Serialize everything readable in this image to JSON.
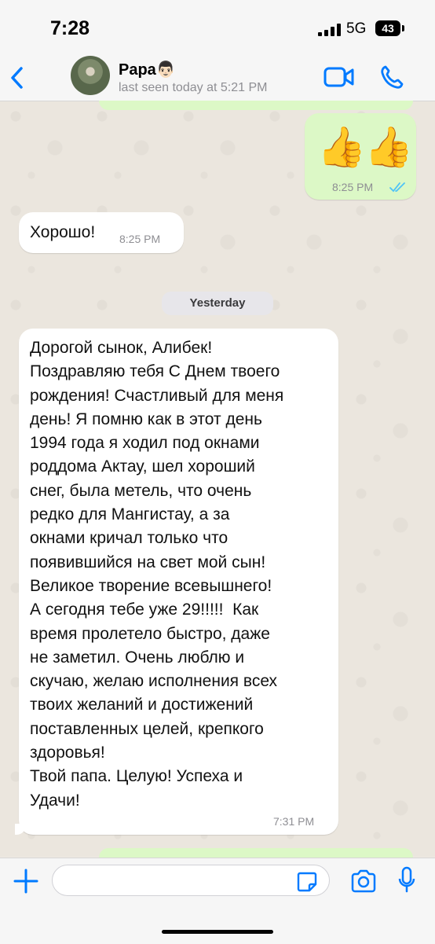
{
  "status_bar": {
    "time": "7:28",
    "network": "5G",
    "battery": "43"
  },
  "header": {
    "contact_name": "Papa",
    "contact_emoji": "👨🏻",
    "last_seen": "last seen today at 5:21 PM",
    "icons": [
      "back-chevron-icon",
      "video-call-icon",
      "phone-call-icon"
    ]
  },
  "messages": [
    {
      "direction": "outgoing",
      "content": "👍👍",
      "time": "8:25 PM",
      "status": "read"
    },
    {
      "direction": "incoming",
      "text": "Хорошо!",
      "time": "8:25 PM"
    },
    {
      "direction": "incoming",
      "lines": [
        "Дорогой сынок, Алибек!",
        "Поздравляю тебя С Днем твоего",
        "рождения! Счастливый для меня",
        "день! Я помню как в этот день",
        "1994 года я ходил под окнами",
        "роддома Актау, шел хороший",
        "снег, была метель, что очень",
        "редко для Мангистау, а за",
        "окнами кричал только что",
        "появившийся на свет мой сын!",
        "Великое творение всевышнего!",
        "А сегодня тебе уже 29!!!!!  Как",
        "время пролетело быстро, даже",
        "не заметил. Очень люблю и",
        "скучаю, желаю исполнения всех",
        "твоих желаний и достижений",
        "поставленных целей, крепкого",
        "здоровья!",
        "Твой папа. Целую! Успеха и",
        "Удачи!"
      ],
      "time": "7:31 PM"
    }
  ],
  "day_separator": "Yesterday",
  "input_bar": {
    "placeholder": "",
    "icons": [
      "plus-icon",
      "sticker-icon",
      "camera-icon",
      "microphone-icon"
    ]
  },
  "colors": {
    "accent": "#007aff",
    "outgoing_bubble": "#dcf8c6",
    "incoming_bubble": "#ffffff",
    "read_ticks": "#4fc3f7"
  }
}
